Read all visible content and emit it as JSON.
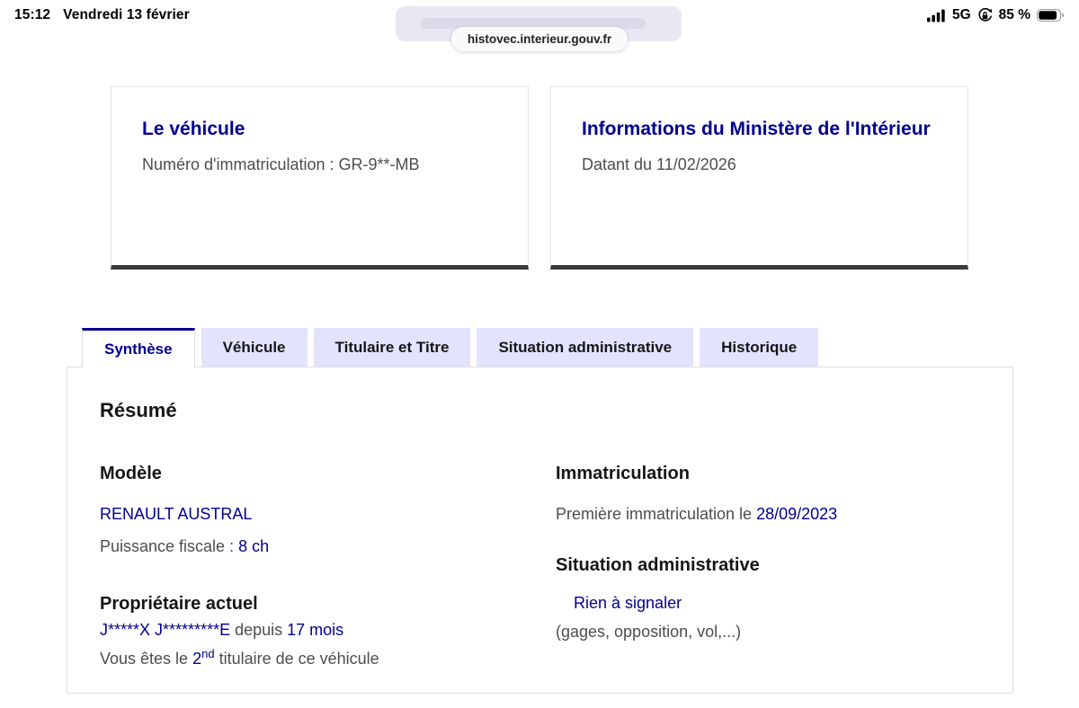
{
  "status_bar": {
    "time": "15:12",
    "date": "Vendredi 13 février",
    "network": "5G",
    "battery_percent": "85 %",
    "battery_level": 85,
    "icons": [
      "signal-bars-icon",
      "orientation-lock-icon",
      "battery-icon"
    ]
  },
  "browser": {
    "url": "histovec.interieur.gouv.fr"
  },
  "cards": {
    "vehicle": {
      "title": "Le véhicule",
      "subtitle": "Numéro d'immatriculation : GR-9**-MB"
    },
    "ministry": {
      "title": "Informations du Ministère de l'Intérieur",
      "subtitle": "Datant du 11/02/2026"
    }
  },
  "tabs": [
    {
      "label": "Synthèse",
      "active": true
    },
    {
      "label": "Véhicule",
      "active": false
    },
    {
      "label": "Titulaire et Titre",
      "active": false
    },
    {
      "label": "Situation administrative",
      "active": false
    },
    {
      "label": "Historique",
      "active": false
    }
  ],
  "panel": {
    "title": "Résumé",
    "model": {
      "heading": "Modèle",
      "name": "RENAULT AUSTRAL",
      "power_label": "Puissance fiscale : ",
      "power_value": "8 ch"
    },
    "owner": {
      "heading": "Propriétaire actuel",
      "name": "J*****X J*********E",
      "since_label": " depuis ",
      "since_value": "17 mois",
      "rank_prefix": "Vous êtes le ",
      "rank_number": "2",
      "rank_ordinal": "nd",
      "rank_rest": " titulaire de ce véhicule"
    },
    "registration": {
      "heading": "Immatriculation",
      "label": "Première immatriculation le ",
      "date": "28/09/2023"
    },
    "admin_status": {
      "heading": "Situation administrative",
      "status": "Rien à signaler",
      "note": "(gages, opposition, vol,...)"
    }
  },
  "colors": {
    "brand_blue": "#000091",
    "tab_inactive_bg": "#e3e3fd",
    "heading_text": "#161616",
    "body_text": "#4d4d4d",
    "card_border": "#e3e3e3",
    "card_bottom_border": "#3a3a3a"
  }
}
